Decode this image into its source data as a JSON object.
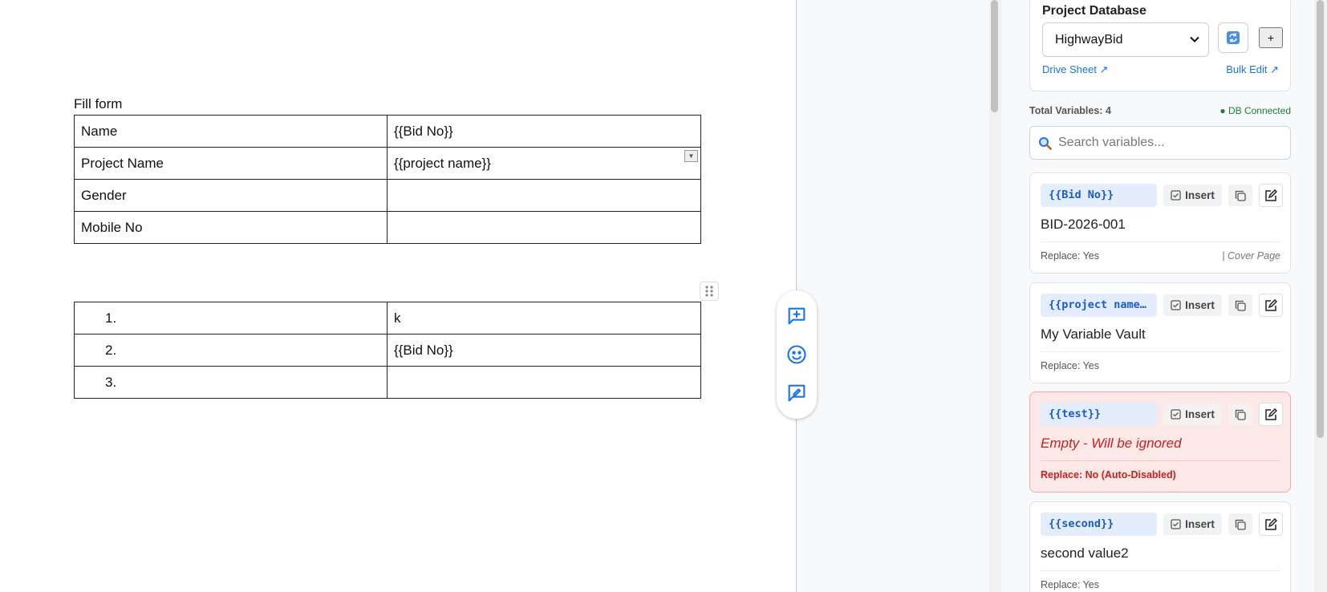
{
  "document": {
    "form_title": "Fill form",
    "form_table": [
      {
        "label": "Name",
        "value": "{{Bid No}}"
      },
      {
        "label": "Project Name",
        "value": "{{project name}}"
      },
      {
        "label": "Gender",
        "value": ""
      },
      {
        "label": "Mobile No",
        "value": ""
      }
    ],
    "list_table": [
      {
        "num": "1.",
        "value": "k"
      },
      {
        "num": "2.",
        "value": "{{Bid No}}"
      },
      {
        "num": "3.",
        "value": ""
      }
    ]
  },
  "side_toolbar": {
    "icons": [
      "add-comment-icon",
      "emoji-icon",
      "suggest-edit-icon"
    ]
  },
  "panel": {
    "db_title": "Project Database",
    "db_selected": "HighwayBid",
    "plus_label": "+",
    "link_drive": "Drive Sheet ↗",
    "link_bulk": "Bulk Edit ↗",
    "total_label": "Total Variables: 4",
    "db_status": "● DB Connected",
    "search_placeholder": "Search variables...",
    "insert_label": "Insert",
    "variables": [
      {
        "name": "{{Bid No}}",
        "value": "BID-2026-001",
        "replace": "Replace: Yes",
        "sheet": "| Cover Page",
        "empty": false
      },
      {
        "name": "{{project name}}",
        "value": "My Variable Vault",
        "replace": "Replace: Yes",
        "sheet": "",
        "empty": false
      },
      {
        "name": "{{test}}",
        "value": "Empty - Will be ignored",
        "replace": "Replace: No (Auto-Disabled)",
        "sheet": "",
        "empty": true
      },
      {
        "name": "{{second}}",
        "value": "second value2",
        "replace": "Replace: Yes",
        "sheet": "",
        "empty": false
      }
    ]
  },
  "colors": {
    "accent": "#1a73e8",
    "chip_text": "#1a5dc8",
    "error": "#c5221f",
    "connected": "#188038"
  }
}
